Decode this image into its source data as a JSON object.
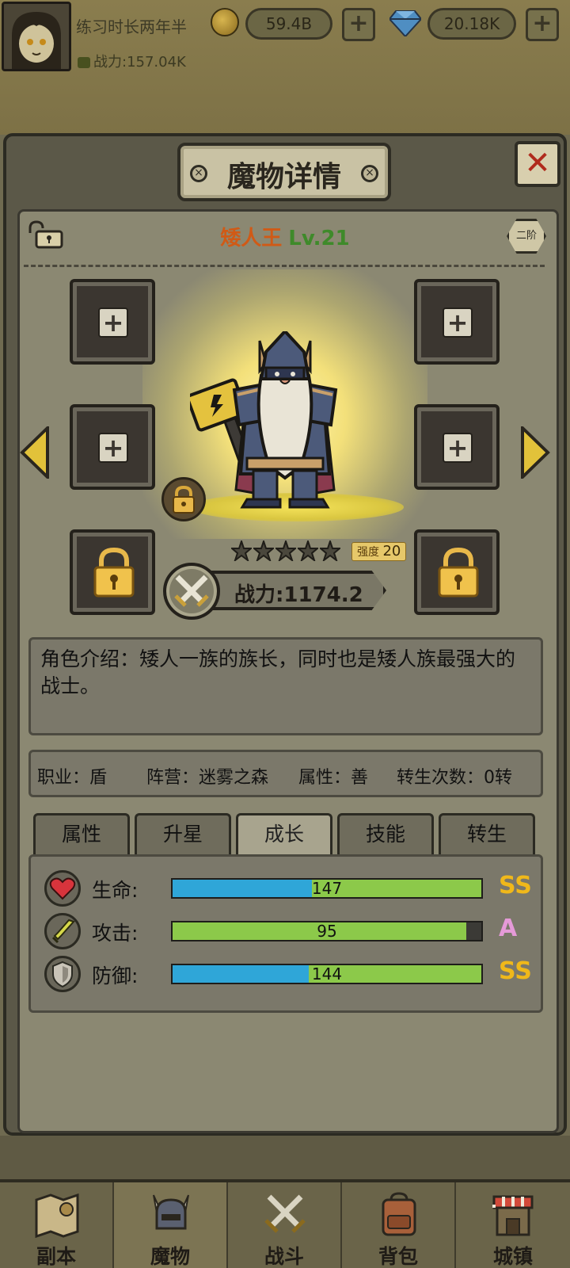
{
  "player": {
    "name": "练习时长两年半",
    "power": "战力:157.04K",
    "gold": "59.4B",
    "gems": "20.18K"
  },
  "modal": {
    "title": "魔物详情",
    "close_icon": "close-icon"
  },
  "monster": {
    "name": "矮人王",
    "level": "Lv.21",
    "rank": "二阶",
    "stars": 5,
    "strength_label": "强度",
    "strength_value": "20",
    "power": "战力:1174.2",
    "description": "角色介绍：矮人一族的族长，同时也是矮人族最强大的战士。"
  },
  "info": {
    "class": "职业：盾",
    "camp": "阵营：迷雾之森",
    "alignment": "属性：善",
    "rebirth": "转生次数：0转"
  },
  "tabs": [
    {
      "label": "属性",
      "active": false
    },
    {
      "label": "升星",
      "active": false
    },
    {
      "label": "成长",
      "active": true
    },
    {
      "label": "技能",
      "active": false
    },
    {
      "label": "转生",
      "active": false
    }
  ],
  "stats": [
    {
      "label": "生命:",
      "value": "147",
      "grade": "SS",
      "grade_color": "#f0b81a",
      "blue_fraction": 0.45,
      "fill_fraction": 1.0,
      "icon": "heart-icon"
    },
    {
      "label": "攻击:",
      "value": "95",
      "grade": "A",
      "grade_color": "#e59ad8",
      "blue_fraction": 0.0,
      "fill_fraction": 0.95,
      "icon": "sword-icon"
    },
    {
      "label": "防御:",
      "value": "144",
      "grade": "SS",
      "grade_color": "#f0b81a",
      "blue_fraction": 0.44,
      "fill_fraction": 1.0,
      "icon": "shield-icon"
    }
  ],
  "nav": [
    {
      "label": "副本",
      "icon": "map-icon",
      "active": false
    },
    {
      "label": "魔物",
      "icon": "monster-helmet-icon",
      "active": true
    },
    {
      "label": "战斗",
      "icon": "crossed-swords-icon",
      "active": false
    },
    {
      "label": "背包",
      "icon": "backpack-icon",
      "active": false
    },
    {
      "label": "城镇",
      "icon": "town-shop-icon",
      "active": false
    }
  ],
  "colors": {
    "name": "#d05a16",
    "level": "#3f8a2a",
    "hp_bar_blue": "#2fa6d8",
    "bar_green": "#8cc94a"
  }
}
